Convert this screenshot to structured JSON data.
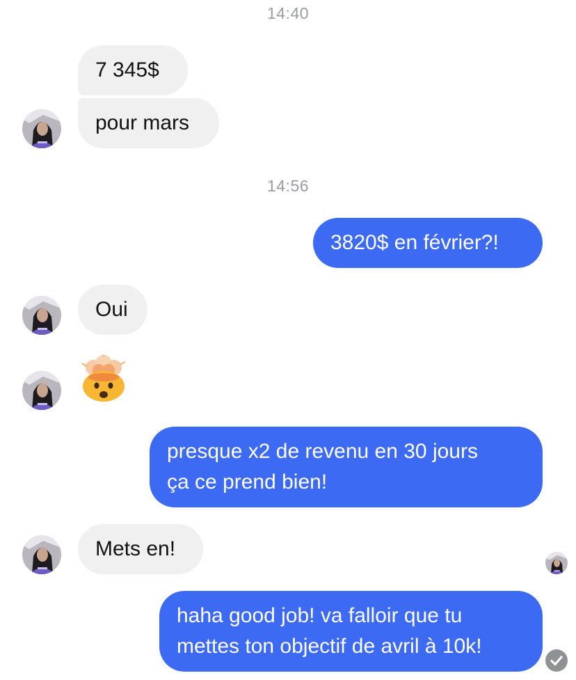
{
  "conversation": {
    "timestamps": [
      "14:40",
      "14:56"
    ],
    "messages": [
      {
        "from": "them",
        "text": "7 345$"
      },
      {
        "from": "them",
        "text": "pour mars"
      },
      {
        "from": "me",
        "text": "3820$ en février?!"
      },
      {
        "from": "them",
        "text": "Oui"
      },
      {
        "from": "them",
        "emoji": "exploding-head-emoji"
      },
      {
        "from": "me",
        "lines": [
          "presque x2 de revenu en 30 jours",
          "ça ce prend bien!"
        ]
      },
      {
        "from": "them",
        "text": "Mets en!"
      },
      {
        "from": "me",
        "lines": [
          "haha good job! va falloir que tu",
          "mettes ton objectif de avril à 10k!"
        ]
      }
    ]
  },
  "colors": {
    "outgoing_bubble": "#3d6af2",
    "incoming_bubble": "#f0f0f0",
    "timestamp": "#9a9ca1",
    "seen_indicator": "#8f9194"
  },
  "icons": {
    "avatar": "contact-avatar-icon",
    "seen": "read-receipt-avatar-icon",
    "delivered": "delivered-check-icon"
  }
}
